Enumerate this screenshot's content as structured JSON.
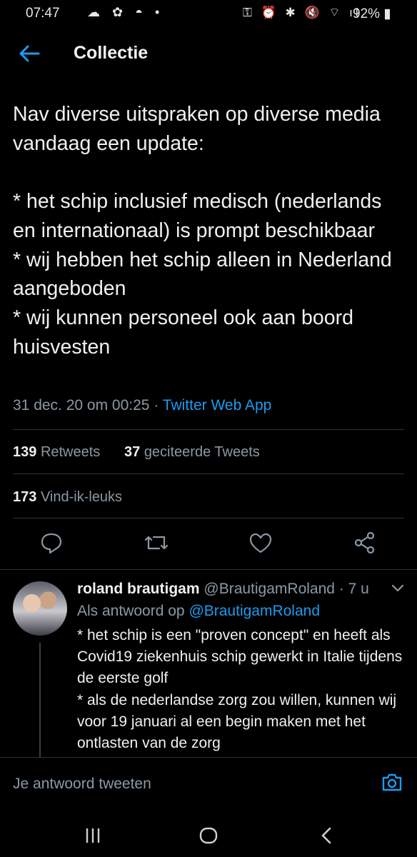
{
  "status_bar": {
    "time": "07:47",
    "battery": "92%"
  },
  "header": {
    "title": "Collectie"
  },
  "tweet": {
    "text": "Nav diverse uitspraken op diverse media vandaag een update:\n\n* het schip inclusief medisch (nederlands en internationaal) is prompt beschikbaar\n* wij hebben het schip alleen in Nederland aangeboden\n* wij kunnen personeel ook aan boord huisvesten",
    "date": "31 dec. 20 om 00:25",
    "separator": " · ",
    "source": "Twitter Web App",
    "retweets_count": "139",
    "retweets_label": "Retweets",
    "quotes_count": "37",
    "quotes_label": "geciteerde Tweets",
    "likes_count": "173",
    "likes_label": "Vind-ik-leuks"
  },
  "reply": {
    "name": "roland brautigam",
    "handle": "@BrautigamRoland",
    "time": "· 7 u",
    "reply_to_label": "Als antwoord op",
    "reply_to_handle": "@BrautigamRoland",
    "text": "* het schip is een \"proven concept\" en heeft als Covid19 ziekenhuis schip gewerkt in Italie tijdens de eerste golf\n* als de nederlandse zorg zou willen, kunnen wij voor 19 januari al een begin maken met het ontlasten van de zorg"
  },
  "compose": {
    "placeholder": "Je antwoord tweeten"
  },
  "colors": {
    "accent": "#1d9bf0",
    "background": "#000000",
    "muted": "#8b98a5"
  }
}
